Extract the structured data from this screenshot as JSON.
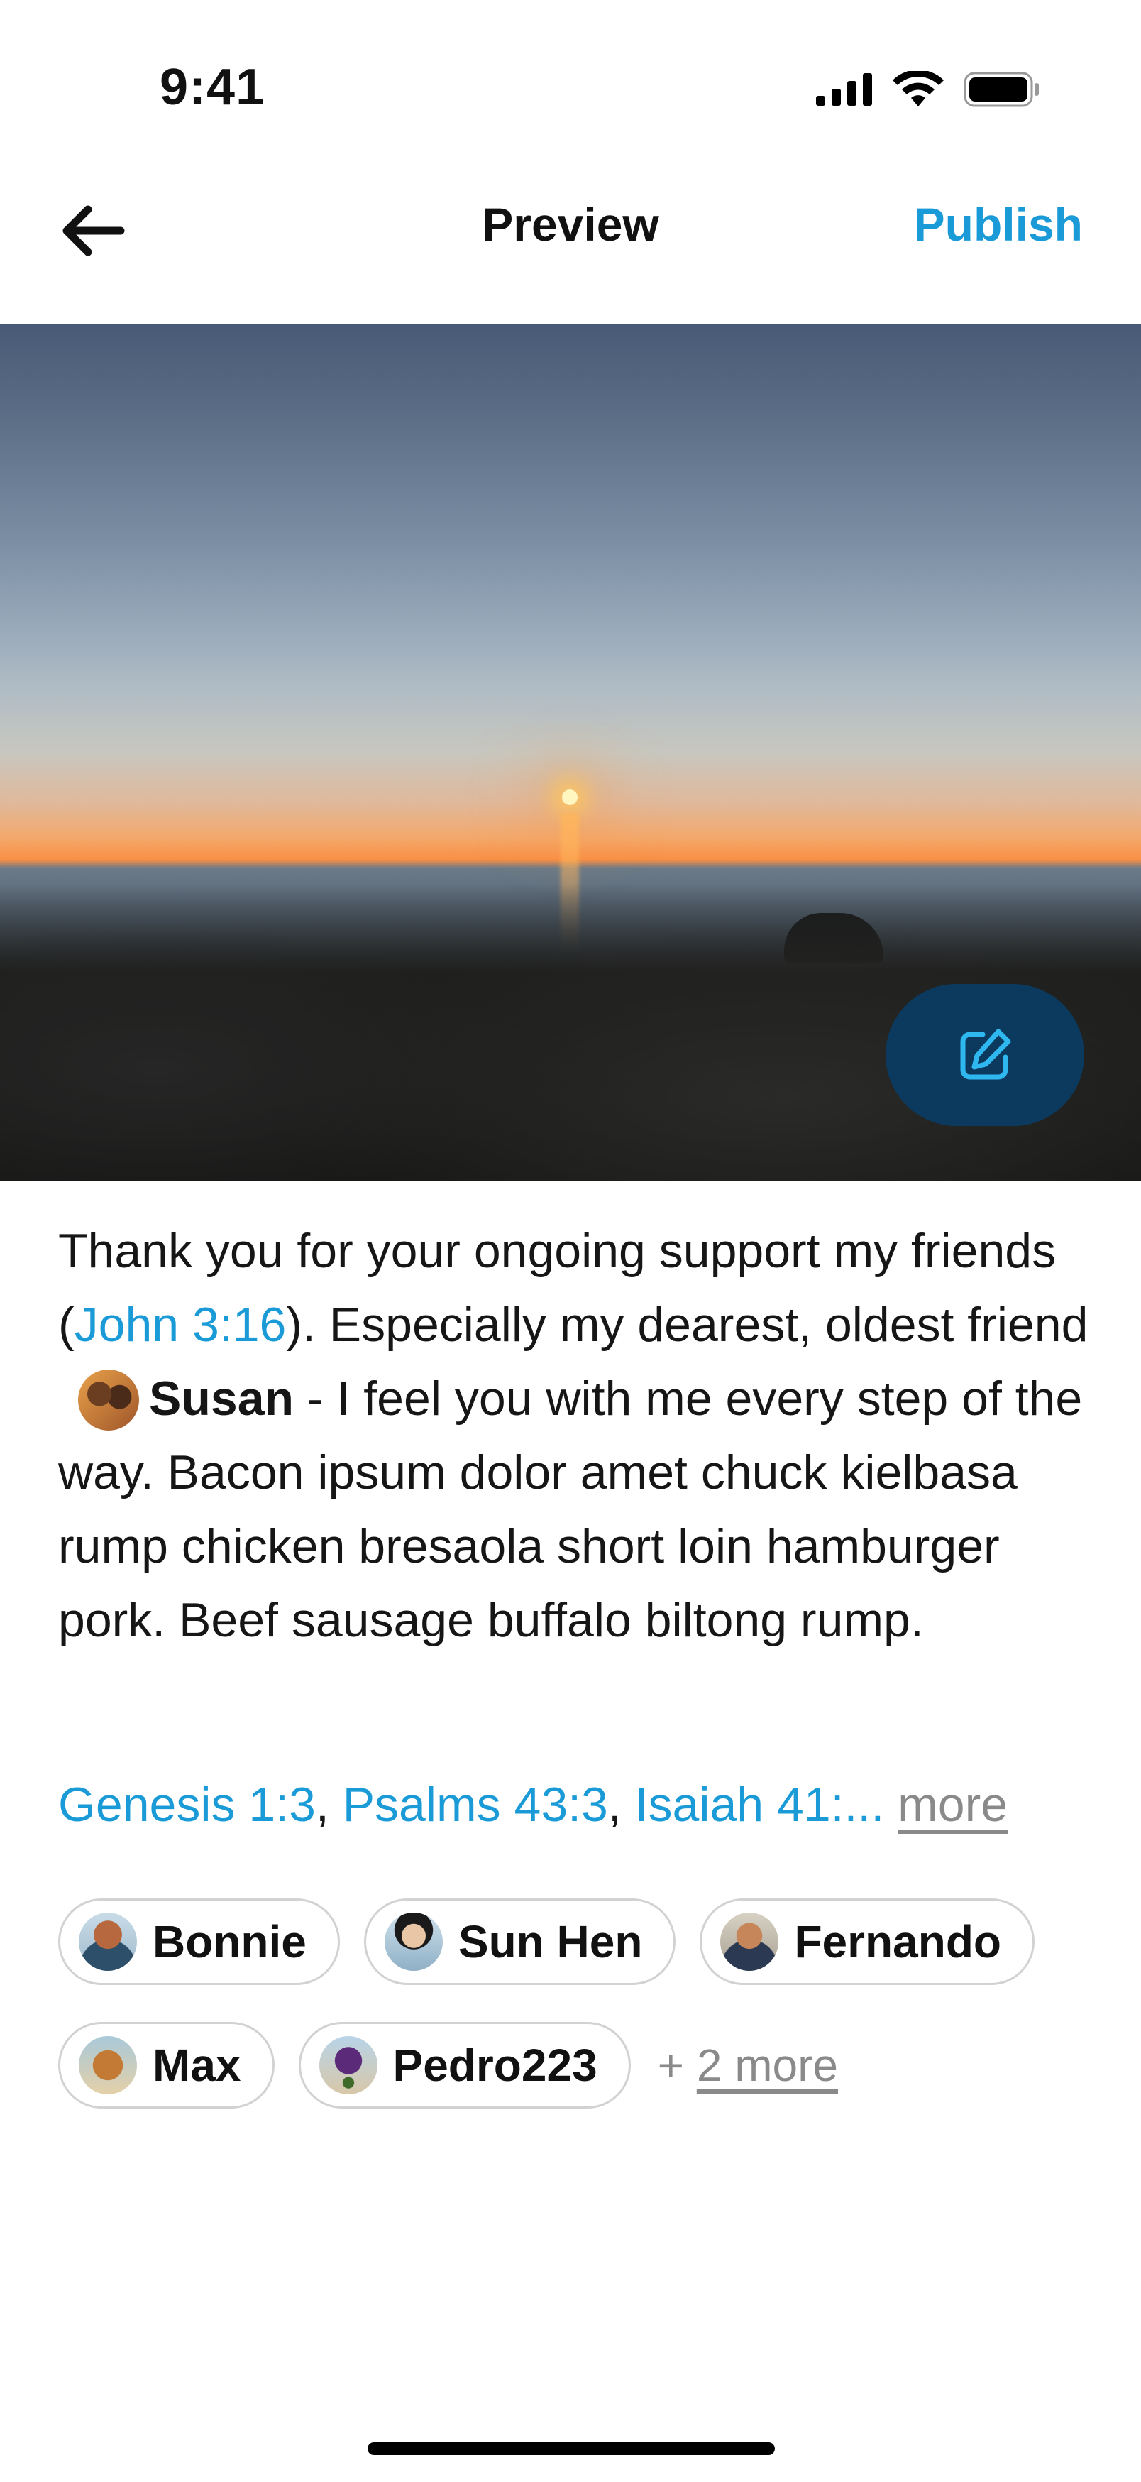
{
  "status_bar": {
    "time": "9:41",
    "icons": [
      "signal-icon",
      "wifi-icon",
      "battery-icon"
    ]
  },
  "nav": {
    "back_icon": "arrow-left-icon",
    "title": "Preview",
    "publish_label": "Publish"
  },
  "photo": {
    "description_icon": "photo",
    "edit_icon": "edit-pencil-icon"
  },
  "caption": {
    "part1": "Thank you for your ongoing support my friends (",
    "verse_link": "John 3:16",
    "part2": "). Especially my dearest, oldest friend",
    "mention_name": "Susan",
    "part3": " - I feel you with me every step of the way. Bacon ipsum dolor amet chuck kielbasa rump chicken bresaola short loin hamburger pork. Beef sausage buffalo biltong rump."
  },
  "references": {
    "items": [
      "Genesis 1:3",
      "Psalms 43:3",
      "Isaiah 41:..."
    ],
    "more_label": "more"
  },
  "people": {
    "chips": [
      {
        "name": "Bonnie"
      },
      {
        "name": "Sun Hen"
      },
      {
        "name": "Fernando"
      },
      {
        "name": "Max"
      },
      {
        "name": "Pedro223"
      }
    ],
    "more_prefix": "+",
    "more_label": "2 more"
  },
  "colors": {
    "accent": "#1a9bd7",
    "fab": "#0b3a5e",
    "muted": "#8a8a8a"
  }
}
